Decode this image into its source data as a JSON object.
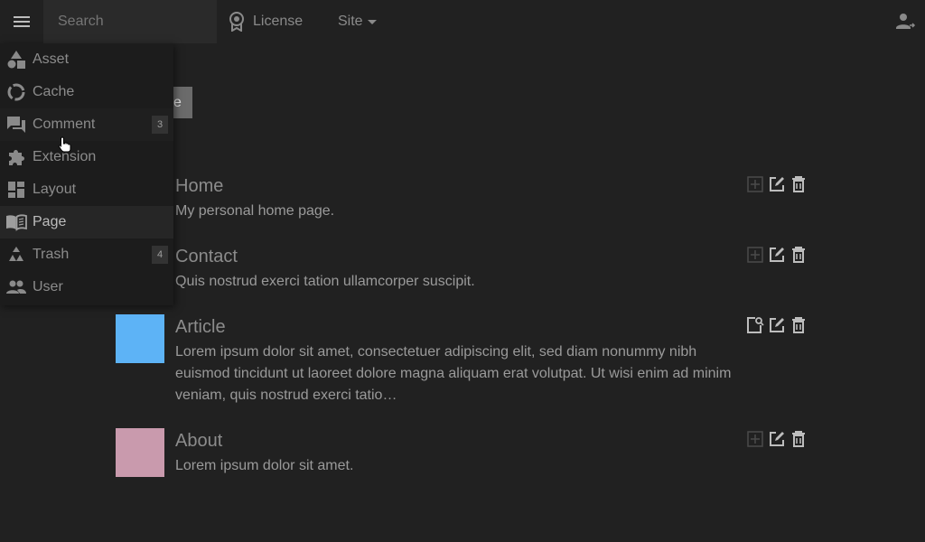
{
  "topbar": {
    "search_placeholder": "Search",
    "license_label": "License",
    "site_label": "Site"
  },
  "background_button_label": "e",
  "menu": {
    "items": [
      {
        "label": "Asset",
        "icon": "shapes-icon",
        "badge": ""
      },
      {
        "label": "Cache",
        "icon": "cache-ring-icon",
        "badge": ""
      },
      {
        "label": "Comment",
        "icon": "forum-icon",
        "badge": "3"
      },
      {
        "label": "Extension",
        "icon": "puzzle-icon",
        "badge": ""
      },
      {
        "label": "Layout",
        "icon": "dashboard-icon",
        "badge": ""
      },
      {
        "label": "Page",
        "icon": "book-open-icon",
        "badge": ""
      },
      {
        "label": "Trash",
        "icon": "recycle-icon",
        "badge": "4"
      },
      {
        "label": "User",
        "icon": "people-icon",
        "badge": ""
      }
    ]
  },
  "pages": [
    {
      "title": "Home",
      "description": "My personal home page.",
      "thumb_color": "",
      "first_action": "add-box-icon"
    },
    {
      "title": "Contact",
      "description": "Quis nostrud exerci tation ullamcorper suscipit.",
      "thumb_color": "",
      "first_action": "add-box-icon"
    },
    {
      "title": "Article",
      "description": "Lorem ipsum dolor sit amet, consectetuer adipiscing elit, sed diam nonummy nibh euismod tincidunt ut laoreet dolore magna aliquam erat volutpat. Ut wisi enim ad minim veniam, quis nostrud exerci tatio…",
      "thumb_color": "#5db3f6",
      "first_action": "find-page-icon"
    },
    {
      "title": "About",
      "description": "Lorem ipsum dolor sit amet.",
      "thumb_color": "#c99aad",
      "first_action": "add-box-icon"
    }
  ],
  "colors": {
    "background": "#212121",
    "menu_background": "#1c1c1c",
    "text": "#9e9e9e"
  }
}
